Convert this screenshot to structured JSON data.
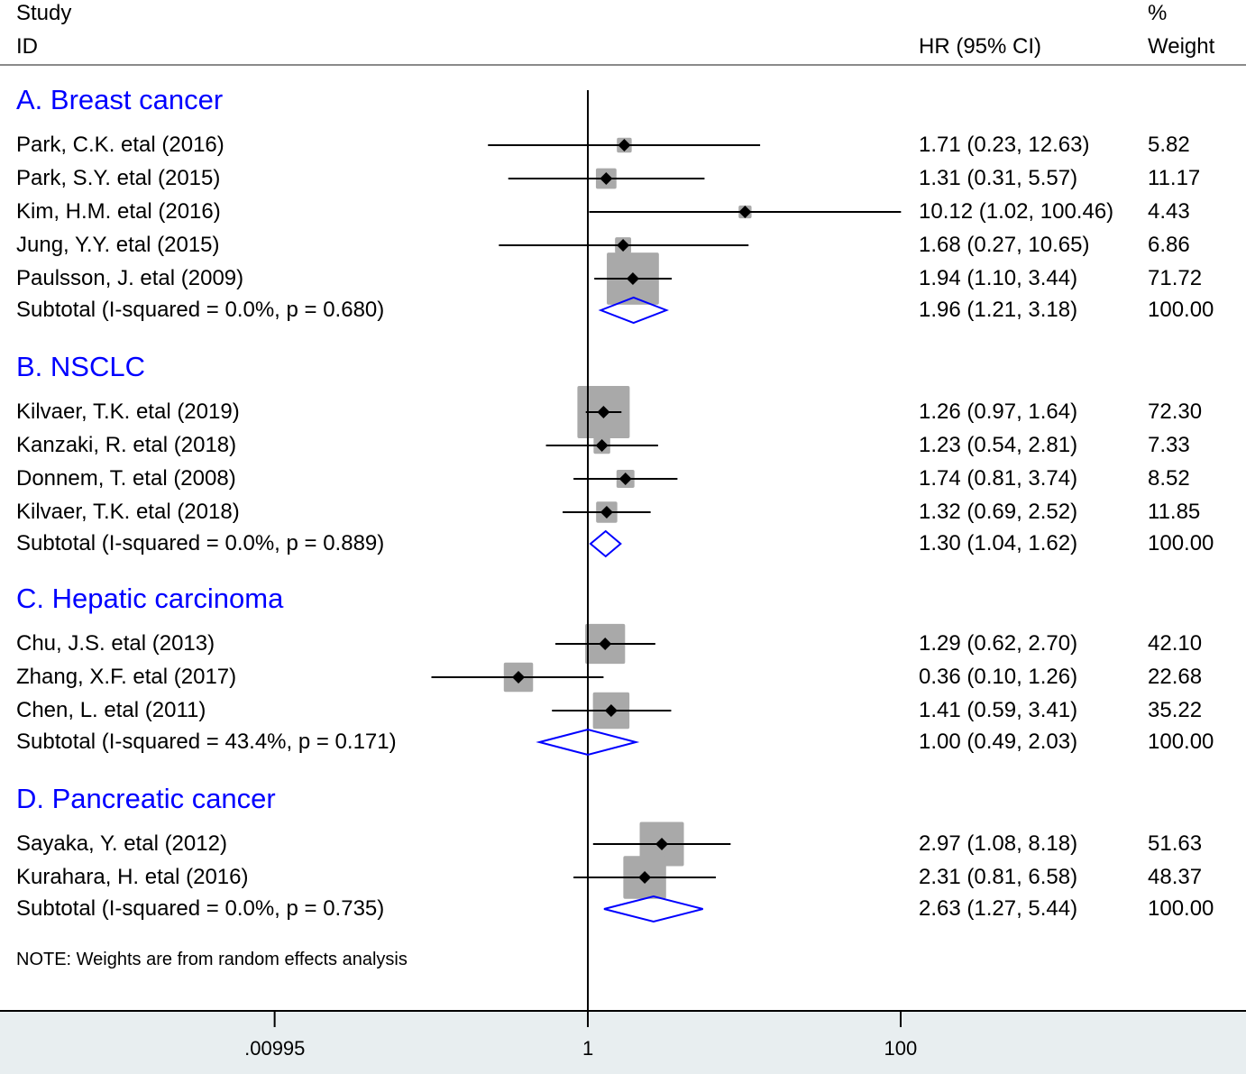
{
  "header": {
    "study_line1": "Study",
    "study_line2": "ID",
    "hr_label": "HR (95% CI)",
    "weight_line1": "%",
    "weight_line2": "Weight"
  },
  "note": "NOTE: Weights are from random effects analysis",
  "colors": {
    "group_title": "#0000ff",
    "diamond": "#0000ff",
    "box": "#a9a9a9",
    "axis_band": "#e8eef0"
  },
  "chart_data": {
    "type": "forest",
    "xscale": "log",
    "xlim": [
      0.00995,
      100.5
    ],
    "ref_line": 1,
    "x_ticks": [
      0.00995,
      1,
      100
    ],
    "x_tick_labels": [
      ".00995",
      "1",
      "100"
    ],
    "column_headers": [
      "Study ID",
      "HR (95% CI)",
      "% Weight"
    ],
    "groups": [
      {
        "title": "A.  Breast cancer",
        "studies": [
          {
            "label": "Park, C.K. etal (2016)",
            "hr": 1.71,
            "lo": 0.23,
            "hi": 12.63,
            "ci_text": "1.71 (0.23, 12.63)",
            "weight": 5.82,
            "weight_text": "5.82"
          },
          {
            "label": "Park, S.Y. etal (2015)",
            "hr": 1.31,
            "lo": 0.31,
            "hi": 5.57,
            "ci_text": "1.31 (0.31, 5.57)",
            "weight": 11.17,
            "weight_text": "11.17"
          },
          {
            "label": "Kim, H.M. etal (2016)",
            "hr": 10.12,
            "lo": 1.02,
            "hi": 100.46,
            "ci_text": "10.12 (1.02, 100.46)",
            "weight": 4.43,
            "weight_text": "4.43"
          },
          {
            "label": "Jung, Y.Y. etal (2015)",
            "hr": 1.68,
            "lo": 0.27,
            "hi": 10.65,
            "ci_text": "1.68 (0.27, 10.65)",
            "weight": 6.86,
            "weight_text": "6.86"
          },
          {
            "label": "Paulsson, J. etal (2009)",
            "hr": 1.94,
            "lo": 1.1,
            "hi": 3.44,
            "ci_text": "1.94 (1.10, 3.44)",
            "weight": 71.72,
            "weight_text": "71.72"
          }
        ],
        "subtotal": {
          "label": "Subtotal  (I-squared = 0.0%, p = 0.680)",
          "hr": 1.96,
          "lo": 1.21,
          "hi": 3.18,
          "ci_text": "1.96 (1.21, 3.18)",
          "weight_text": "100.00"
        }
      },
      {
        "title": "B.  NSCLC",
        "studies": [
          {
            "label": "Kilvaer, T.K. etal (2019)",
            "hr": 1.26,
            "lo": 0.97,
            "hi": 1.64,
            "ci_text": "1.26 (0.97, 1.64)",
            "weight": 72.3,
            "weight_text": "72.30"
          },
          {
            "label": "Kanzaki, R. etal (2018)",
            "hr": 1.23,
            "lo": 0.54,
            "hi": 2.81,
            "ci_text": "1.23 (0.54, 2.81)",
            "weight": 7.33,
            "weight_text": "7.33"
          },
          {
            "label": "Donnem, T. etal (2008)",
            "hr": 1.74,
            "lo": 0.81,
            "hi": 3.74,
            "ci_text": "1.74 (0.81, 3.74)",
            "weight": 8.52,
            "weight_text": "8.52"
          },
          {
            "label": "Kilvaer, T.K. etal (2018)",
            "hr": 1.32,
            "lo": 0.69,
            "hi": 2.52,
            "ci_text": "1.32 (0.69, 2.52)",
            "weight": 11.85,
            "weight_text": "11.85"
          }
        ],
        "subtotal": {
          "label": "Subtotal  (I-squared = 0.0%, p = 0.889)",
          "hr": 1.3,
          "lo": 1.04,
          "hi": 1.62,
          "ci_text": "1.30 (1.04, 1.62)",
          "weight_text": "100.00"
        }
      },
      {
        "title": "C.  Hepatic carcinoma",
        "studies": [
          {
            "label": "Chu, J.S. etal  (2013)",
            "hr": 1.29,
            "lo": 0.62,
            "hi": 2.7,
            "ci_text": "1.29 (0.62, 2.70)",
            "weight": 42.1,
            "weight_text": "42.10"
          },
          {
            "label": "Zhang, X.F. etal (2017)",
            "hr": 0.36,
            "lo": 0.1,
            "hi": 1.26,
            "ci_text": "0.36 (0.10, 1.26)",
            "weight": 22.68,
            "weight_text": "22.68"
          },
          {
            "label": "Chen, L. etal (2011)",
            "hr": 1.41,
            "lo": 0.59,
            "hi": 3.41,
            "ci_text": "1.41 (0.59, 3.41)",
            "weight": 35.22,
            "weight_text": "35.22"
          }
        ],
        "subtotal": {
          "label": "Subtotal  (I-squared = 43.4%, p = 0.171)",
          "hr": 1.0,
          "lo": 0.49,
          "hi": 2.03,
          "ci_text": "1.00 (0.49, 2.03)",
          "weight_text": "100.00"
        }
      },
      {
        "title": "D.  Pancreatic cancer",
        "studies": [
          {
            "label": "Sayaka, Y. etal (2012)",
            "hr": 2.97,
            "lo": 1.08,
            "hi": 8.18,
            "ci_text": "2.97 (1.08, 8.18)",
            "weight": 51.63,
            "weight_text": "51.63"
          },
          {
            "label": "Kurahara, H. etal  (2016)",
            "hr": 2.31,
            "lo": 0.81,
            "hi": 6.58,
            "ci_text": "2.31 (0.81, 6.58)",
            "weight": 48.37,
            "weight_text": "48.37"
          }
        ],
        "subtotal": {
          "label": "Subtotal  (I-squared = 0.0%, p = 0.735)",
          "hr": 2.63,
          "lo": 1.27,
          "hi": 5.44,
          "ci_text": "2.63 (1.27, 5.44)",
          "weight_text": "100.00"
        }
      }
    ]
  }
}
